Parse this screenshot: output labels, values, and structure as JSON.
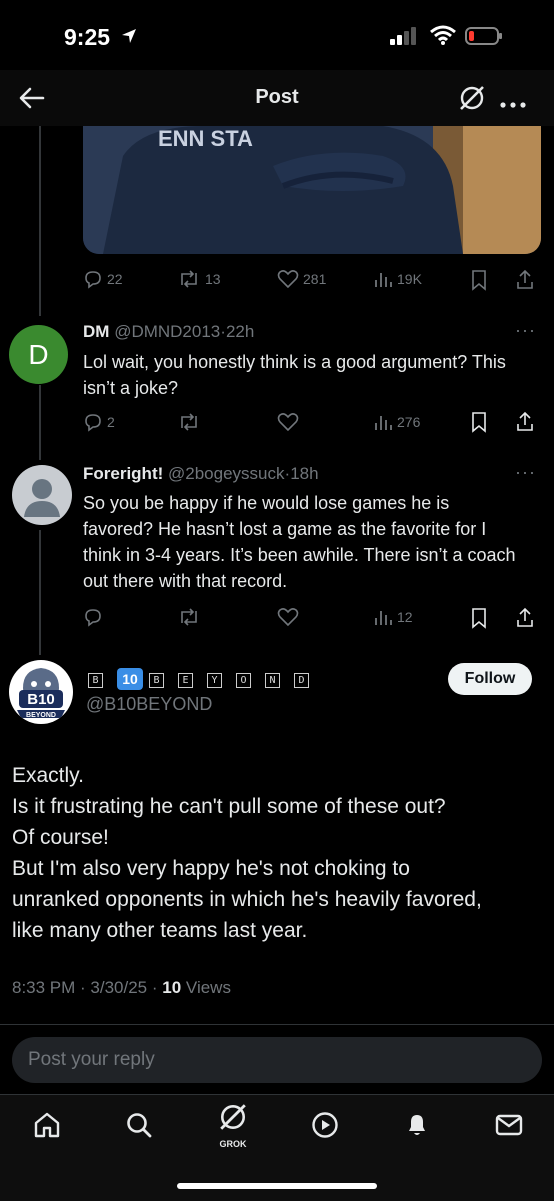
{
  "status": {
    "time": "9:25"
  },
  "header": {
    "title": "Post"
  },
  "main_tweet_actions": {
    "replies": "22",
    "reposts": "13",
    "likes": "281",
    "views": "19K"
  },
  "replies": [
    {
      "initial": "D",
      "name": "DM",
      "handle": "@DMND2013",
      "time": "22h",
      "text": "Lol wait, you honestly think is a good argument? This isn’t a joke?",
      "replies": "2",
      "views": "276",
      "avatar_color": "#3a8a2f"
    },
    {
      "name": "Foreright!",
      "handle": "@2bogeyssuck",
      "time": "18h",
      "text": "So you be happy if he would lose games he is favored? He hasn’t lost a game as the favorite for I think in 3-4 years. It’s been awhile. There isn’t a coach out there with that record.",
      "views": "12"
    }
  ],
  "focused": {
    "display_name_chars": [
      "B",
      "10",
      "B",
      "E",
      "Y",
      "O",
      "N",
      "D"
    ],
    "handle": "@B10BEYOND",
    "follow_label": "Follow",
    "logo_text": "B10",
    "logo_subtext": "BEYOND",
    "lines": [
      "Exactly.",
      "Is it frustrating he can't pull some of these out?",
      "Of course!",
      "But I'm also very happy he's not choking to",
      "unranked opponents in which he's heavily favored,",
      "like many other teams last year."
    ],
    "time": "8:33 PM",
    "date": "3/30/25",
    "views_count": "10",
    "views_label": "Views"
  },
  "reply_box": {
    "placeholder": "Post your reply"
  },
  "tabbar": {
    "grok_label": "GROK"
  },
  "colors": {
    "accent": "#1d9bf0",
    "muted": "#71767b",
    "battery_red": "#ff3b30"
  }
}
